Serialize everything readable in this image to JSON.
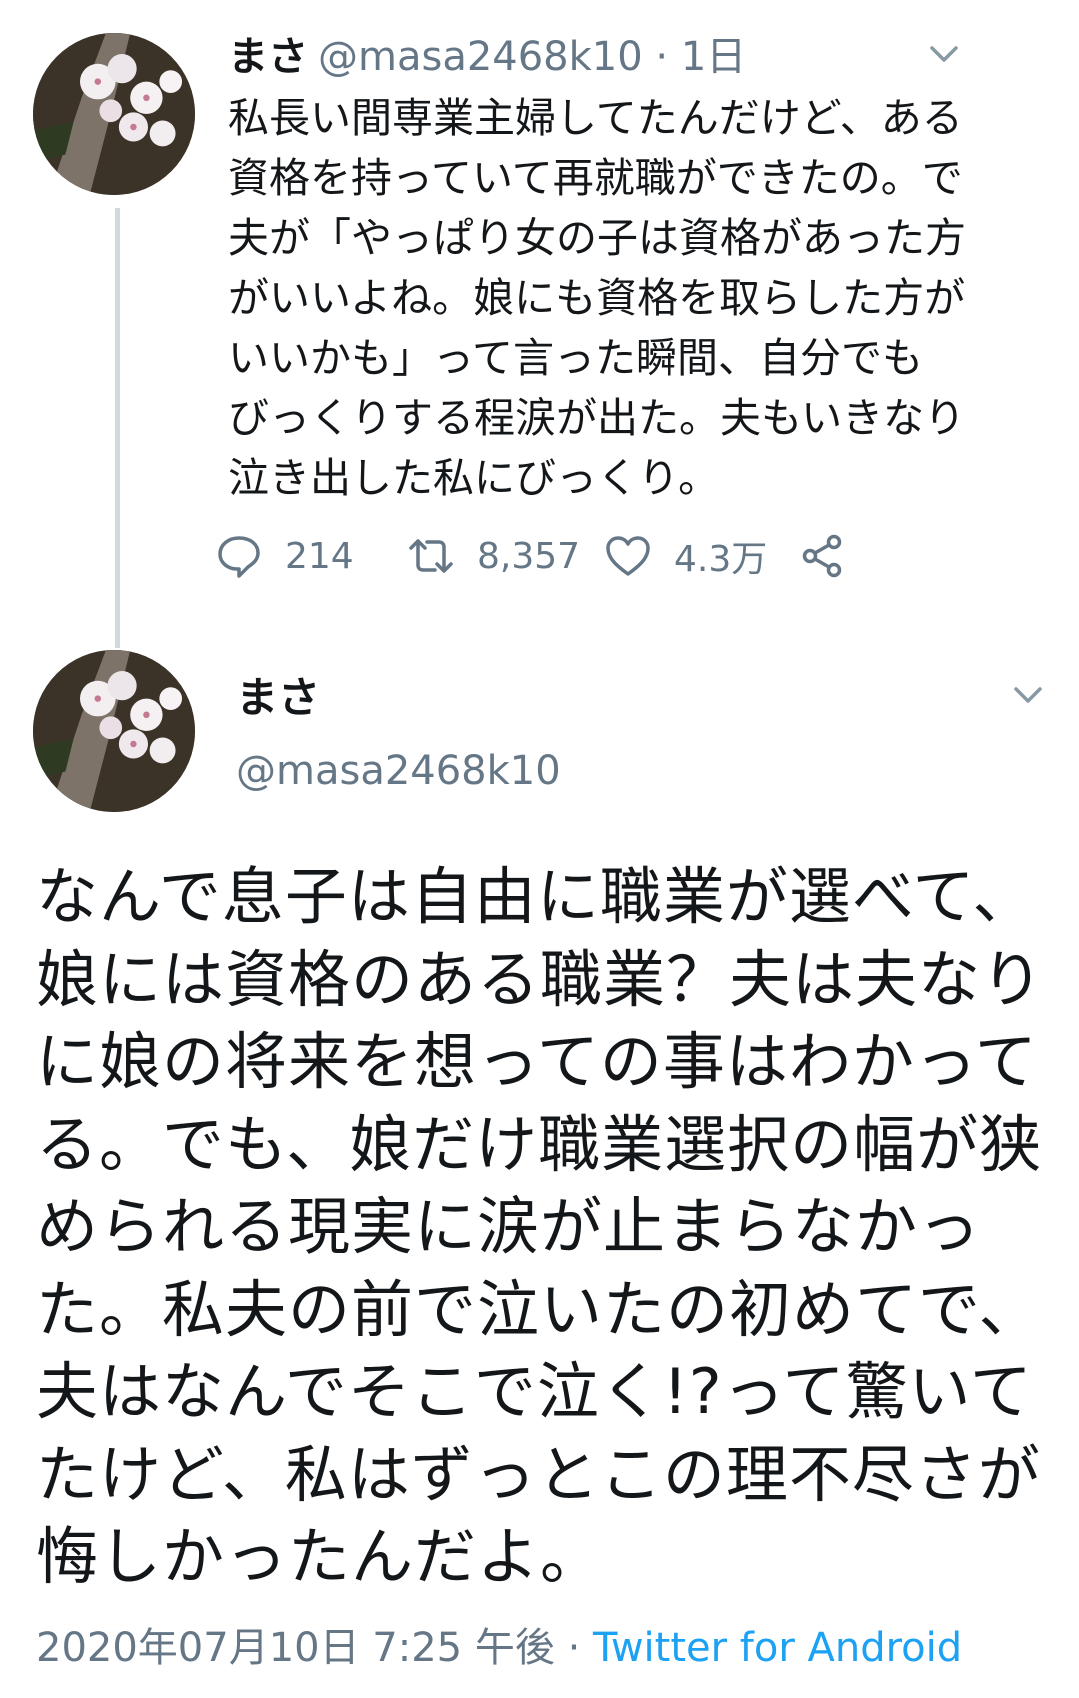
{
  "tweet1": {
    "name": "まさ",
    "meta": "@masa2468k10 · 1日",
    "text": "私長い間専業主婦してたんだけど、ある\n資格を持っていて再就職ができたの。で\n夫が「やっぱり女の子は資格があった方\nがいいよね。娘にも資格を取らした方が\nいいかも」って言った瞬間、自分でも\nびっくりする程涙が出た。夫もいきなり\n泣き出した私にびっくり。",
    "actions": {
      "reply_count": "214",
      "retweet_count": "8,357",
      "like_count": "4.3万"
    }
  },
  "tweet2": {
    "name": "まさ",
    "handle": "@masa2468k10",
    "text": "なんで息子は自由に職業が選べて、\n娘には資格のある職業？夫は夫なり\nに娘の将来を想っての事はわかって\nる。でも、娘だけ職業選択の幅が狭\nめられる現実に涙が止まらなかっ\nた。私夫の前で泣いたの初めてで、\n夫はなんでそこで泣く!?って驚いて\nたけど、私はずっとこの理不尽さが\n悔しかったんだよ。",
    "timestamp": "2020年07月10日 7:25 午後",
    "separator": "·",
    "source": "Twitter for Android"
  },
  "colors": {
    "text": "#14171a",
    "secondary": "#657786",
    "link": "#1da1f2",
    "thread_line": "#cfd9de"
  },
  "icons": {
    "reply": "reply-icon",
    "retweet": "retweet-icon",
    "like": "heart-icon",
    "share": "share-icon",
    "menu": "chevron-down-icon"
  }
}
